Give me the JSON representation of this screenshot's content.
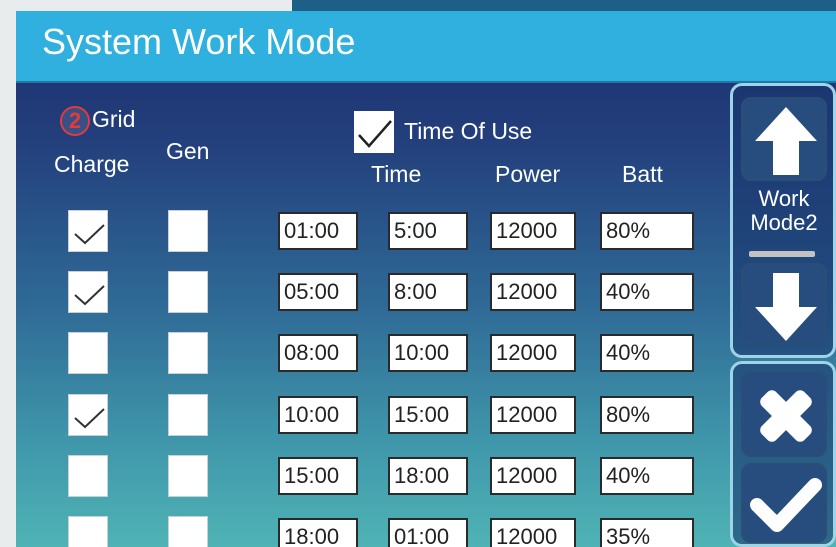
{
  "title": "System Work Mode",
  "badge": "2",
  "labels": {
    "grid": "Grid",
    "charge": "Charge",
    "gen": "Gen",
    "time_of_use": "Time Of Use",
    "time": "Time",
    "power": "Power",
    "batt": "Batt"
  },
  "time_of_use_checked": true,
  "rows": [
    {
      "start": "01:00",
      "end": "5:00",
      "power": "12000",
      "batt": "80%",
      "grid_charge": true,
      "gen": false
    },
    {
      "start": "05:00",
      "end": "8:00",
      "power": "12000",
      "batt": "40%",
      "grid_charge": true,
      "gen": false
    },
    {
      "start": "08:00",
      "end": "10:00",
      "power": "12000",
      "batt": "40%",
      "grid_charge": false,
      "gen": false
    },
    {
      "start": "10:00",
      "end": "15:00",
      "power": "12000",
      "batt": "80%",
      "grid_charge": true,
      "gen": false
    },
    {
      "start": "15:00",
      "end": "18:00",
      "power": "12000",
      "batt": "40%",
      "grid_charge": false,
      "gen": false
    },
    {
      "start": "18:00",
      "end": "01:00",
      "power": "12000",
      "batt": "35%",
      "grid_charge": false,
      "gen": false
    }
  ],
  "side": {
    "mode_line1": "Work",
    "mode_line2": "Mode2",
    "up_icon": "arrow-up-icon",
    "down_icon": "arrow-down-icon",
    "cancel_icon": "close-icon",
    "confirm_icon": "check-icon"
  },
  "colors": {
    "title_bar": "#2fb0df",
    "badge": "#e43a3a",
    "button": "#264d7e"
  }
}
